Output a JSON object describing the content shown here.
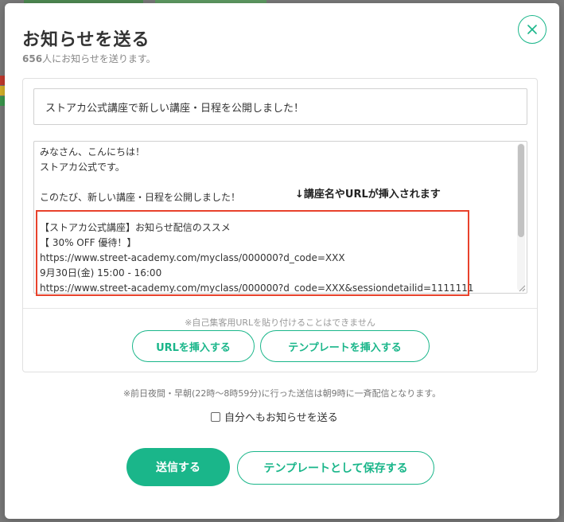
{
  "modal": {
    "title": "お知らせを送る",
    "recipient_count": "656",
    "recipient_suffix": "人にお知らせを送ります。"
  },
  "form": {
    "subject_value": "ストアカ公式講座で新しい講座・日程を公開しました！",
    "body_lines": [
      "みなさん、こんにちは！",
      "ストアカ公式です。",
      "",
      "このたび、新しい講座・日程を公開しました！",
      "",
      "【ストアカ公式講座】お知らせ配信のススメ",
      "【 30% OFF 優待！】",
      "https://www.street-academy.com/myclass/000000?d_code=XXX",
      "9月30日(金) 15:00 - 16:00",
      "https://www.street-academy.com/myclass/000000?d_code=XXX&sessiondetailid=1111111"
    ],
    "annotation": "↓講座名やURLが挿入されます",
    "url_note": "※自己集客用URLを貼り付けることはできません",
    "insert_url_label": "URLを挿入する",
    "insert_template_label": "テンプレートを挿入する"
  },
  "footer": {
    "schedule_note": "※前日夜間・早朝(22時〜8時59分)に行った送信は朝9時に一斉配信となります。",
    "self_notify_label": "自分へもお知らせを送る",
    "self_notify_checked": false,
    "send_label": "送信する",
    "save_template_label": "テンプレートとして保存する"
  },
  "colors": {
    "accent": "#1ab68a",
    "highlight": "#e8422c"
  },
  "icons": {
    "close": "close-icon",
    "resize": "resize-handle-icon"
  }
}
